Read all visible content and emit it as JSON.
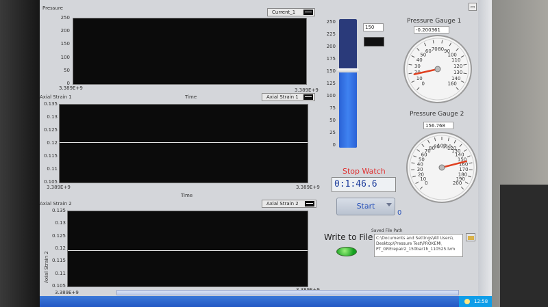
{
  "charts": {
    "pressure": {
      "title": "Pressure",
      "legend": "Current_1",
      "y_ticks": [
        "250",
        "200",
        "150",
        "100",
        "50",
        "0"
      ],
      "x_start": "3.389E+9",
      "x_end": "3.389E+9"
    },
    "strain1": {
      "title": "Axial Strain 1",
      "legend": "Axial Strain 1",
      "y_ticks": [
        "0.135",
        "0.13",
        "0.125",
        "0.12",
        "0.115",
        "0.11",
        "0.105"
      ],
      "x_start": "3.389E+9",
      "x_end": "3.389E+9",
      "x_title": "Time",
      "trace_value": 0.1205
    },
    "strain2": {
      "title": "Axial Strain 2",
      "legend": "Axial Strain 2",
      "y_axis_title": "Axial Strain 2",
      "y_ticks": [
        "0.135",
        "0.13",
        "0.125",
        "0.12",
        "0.115",
        "0.11",
        "0.105"
      ],
      "x_start": "3.389E+9",
      "x_end": "3.389E+9",
      "x_title": "Time",
      "trace_value": 0.1195
    },
    "pressure_x_title": "Time"
  },
  "tank": {
    "value_label": "150",
    "level": 150,
    "max": 250,
    "ticks": [
      "250",
      "225",
      "200",
      "175",
      "150",
      "125",
      "100",
      "75",
      "50",
      "25",
      "0"
    ]
  },
  "gauge1": {
    "title": "Pressure Gauge 1",
    "readout": "-0.200361",
    "labels": [
      "0",
      "10",
      "20",
      "30",
      "40",
      "50",
      "60",
      "70",
      "80",
      "90",
      "100",
      "110",
      "120",
      "130",
      "140",
      "160"
    ],
    "needle_fraction": 0.12
  },
  "gauge2": {
    "title": "Pressure Gauge 2",
    "readout": "156.768",
    "labels": [
      "0",
      "10",
      "20",
      "30",
      "40",
      "50",
      "60",
      "70",
      "80",
      "90",
      "100",
      "110",
      "120",
      "130",
      "140",
      "150",
      "160",
      "170",
      "180",
      "190",
      "200"
    ],
    "needle_fraction": 0.78
  },
  "stopwatch": {
    "label": "Stop Watch",
    "time": "0:1:46.6"
  },
  "start": {
    "label": "Start",
    "count": "0"
  },
  "write": {
    "label": "Write to File",
    "path_label": "Saved File Path",
    "path_lines": [
      "C:\\Documents and Settings\\All Users\\",
      "Desktop\\Pressure Test\\PROKEM\\",
      "PT_GRErepair2_150bar1h_110525.lvm"
    ]
  },
  "taskbar": {
    "clock": "12:58"
  },
  "colors": {
    "plot_bg": "#0b0b0b",
    "tank_fill": "#3f82f0",
    "needle": "#e04020",
    "stopwatch_text": "#e03030",
    "led_on": "#14a020"
  }
}
